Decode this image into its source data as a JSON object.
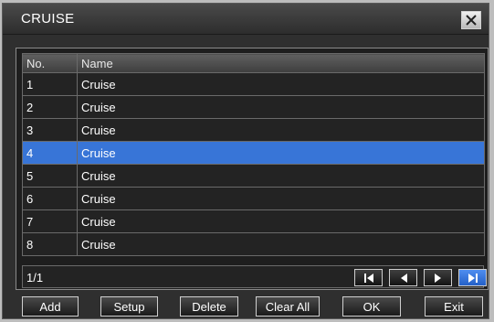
{
  "window": {
    "title": "CRUISE"
  },
  "table": {
    "columns": [
      "No.",
      "Name"
    ],
    "rows": [
      {
        "no": "1",
        "name": "Cruise"
      },
      {
        "no": "2",
        "name": "Cruise"
      },
      {
        "no": "3",
        "name": "Cruise"
      },
      {
        "no": "4",
        "name": "Cruise"
      },
      {
        "no": "5",
        "name": "Cruise"
      },
      {
        "no": "6",
        "name": "Cruise"
      },
      {
        "no": "7",
        "name": "Cruise"
      },
      {
        "no": "8",
        "name": "Cruise"
      }
    ],
    "selected_row": "4",
    "page": "1/1"
  },
  "navigation": [
    "first-page-icon",
    "previous-page-icon",
    "next-page-icon",
    "last-page-icon"
  ],
  "buttons": {
    "add": "Add",
    "setup": "Setup",
    "delete": "Delete",
    "clear_all": "Clear All",
    "ok": "OK",
    "exit": "Exit"
  },
  "colors": {
    "selection": "#3875d7",
    "active_nav": "#2f6fd8",
    "background": "#2f2f2f"
  }
}
